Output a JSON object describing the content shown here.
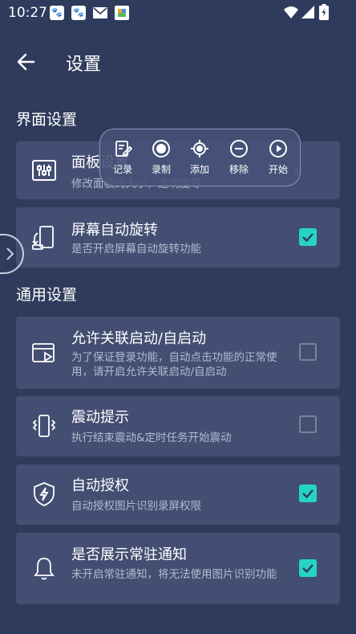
{
  "status_bar": {
    "time": "10:27"
  },
  "app_bar": {
    "title": "设置"
  },
  "sections": {
    "interface": "界面设置",
    "general": "通用设置"
  },
  "settings": {
    "panel": {
      "title": "面板设置",
      "subtitle": "修改面板的大小，透明度等"
    },
    "rotation": {
      "title": "屏幕自动旋转",
      "subtitle": "是否开启屏幕自动旋转功能",
      "checked": true
    },
    "autostart": {
      "title": "允许关联启动/自启动",
      "subtitle": "为了保证登录功能，自动点击功能的正常使用，请开启允许关联启动/自启动",
      "checked": false
    },
    "vibrate": {
      "title": "震动提示",
      "subtitle": "执行结束震动&定时任务开始震动",
      "checked": false
    },
    "authorize": {
      "title": "自动授权",
      "subtitle": "自动授权图片识别录屏权限",
      "checked": true
    },
    "notification": {
      "title": "是否展示常驻通知",
      "subtitle": "未开启常驻通知，将无法使用图片识别功能",
      "checked": true
    }
  },
  "toolbar": {
    "record_log": "记录",
    "record": "录制",
    "add": "添加",
    "remove": "移除",
    "start": "开始"
  },
  "colors": {
    "background": "#2f3b5c",
    "card": "#434e72",
    "accent": "#26d4c4"
  },
  "icons": {
    "status": [
      "paw-icon",
      "paw-icon",
      "mail-icon",
      "app-icon",
      "wifi-icon",
      "signal-icon",
      "battery-icon"
    ]
  }
}
